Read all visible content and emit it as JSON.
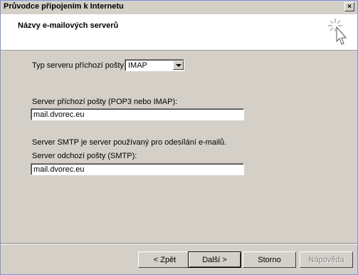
{
  "window": {
    "title": "Průvodce připojením k Internetu",
    "close_glyph": "×"
  },
  "header": {
    "title": "Názvy e-mailových serverů",
    "icon": "wizard-sparkle-icon"
  },
  "form": {
    "incoming_type_label": "Typ serveru příchozí pošty:",
    "incoming_type_value": "IMAP",
    "incoming_server_label": "Server příchozí pošty (POP3 nebo IMAP):",
    "incoming_server_value": "mail.dvorec.eu",
    "smtp_note": "Server SMTP je server používaný pro odesílání e-mailů.",
    "outgoing_server_label": "Server odchozí pošty (SMTP):",
    "outgoing_server_value": "mail.dvorec.eu"
  },
  "buttons": {
    "back": "< Zpět",
    "next": "Další >",
    "cancel": "Storno",
    "help": "Nápověda"
  }
}
